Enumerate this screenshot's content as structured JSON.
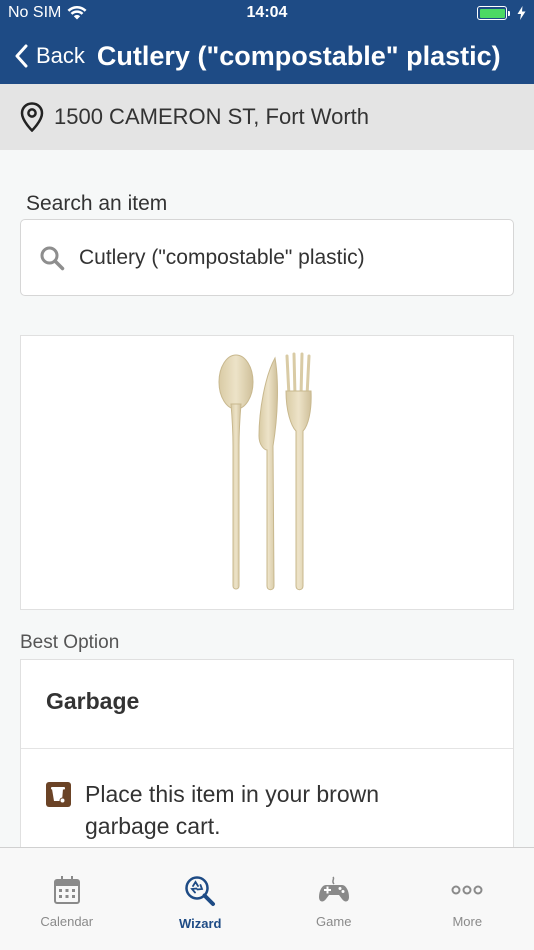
{
  "status_bar": {
    "carrier": "No SIM",
    "time": "14:04"
  },
  "nav": {
    "back_label": "Back",
    "title": "Cutlery (\"compostable\" plastic)"
  },
  "location": {
    "address": "1500 CAMERON ST, Fort Worth"
  },
  "search": {
    "label": "Search an item",
    "value": "Cutlery (\"compostable\" plastic)"
  },
  "result": {
    "section_label": "Best Option",
    "title": "Garbage",
    "description": "Place this item in your brown garbage cart."
  },
  "tabs": [
    {
      "label": "Calendar",
      "icon": "calendar-icon",
      "active": false
    },
    {
      "label": "Wizard",
      "icon": "wizard-search-icon",
      "active": true
    },
    {
      "label": "Game",
      "icon": "gamepad-icon",
      "active": false
    },
    {
      "label": "More",
      "icon": "more-icon",
      "active": false
    }
  ],
  "colors": {
    "brand": "#1e4b85",
    "cart_brown": "#6b4326",
    "battery_green": "#4cd964"
  }
}
